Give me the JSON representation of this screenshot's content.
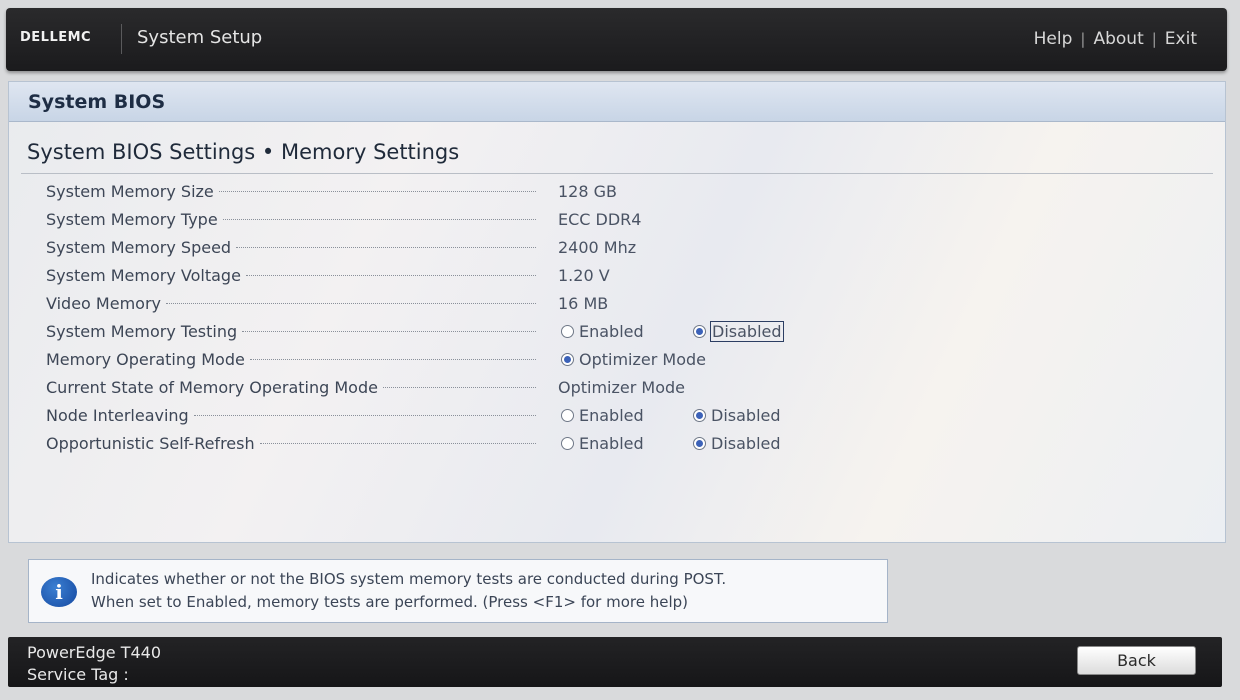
{
  "header": {
    "logo_text": "DELLEMC",
    "app_title": "System Setup",
    "links": [
      "Help",
      "About",
      "Exit"
    ],
    "link_separator": "|"
  },
  "panel": {
    "title": "System BIOS",
    "breadcrumb": "System BIOS Settings • Memory Settings"
  },
  "settings": [
    {
      "label": "System Memory Size",
      "value": "128 GB"
    },
    {
      "label": "System Memory Type",
      "value": "ECC DDR4"
    },
    {
      "label": "System Memory Speed",
      "value": "2400 Mhz"
    },
    {
      "label": "System Memory Voltage",
      "value": "1.20 V"
    },
    {
      "label": "Video Memory",
      "value": "16 MB"
    },
    {
      "label": "System Memory Testing",
      "options": [
        "Enabled",
        "Disabled"
      ],
      "selected": "Disabled"
    },
    {
      "label": "Memory Operating Mode",
      "options": [
        "Optimizer Mode"
      ],
      "selected": "Optimizer Mode"
    },
    {
      "label": "Current State of Memory Operating Mode",
      "value": "Optimizer Mode"
    },
    {
      "label": "Node Interleaving",
      "options": [
        "Enabled",
        "Disabled"
      ],
      "selected": "Disabled"
    },
    {
      "label": "Opportunistic Self-Refresh",
      "options": [
        "Enabled",
        "Disabled"
      ],
      "selected": "Disabled"
    }
  ],
  "help": {
    "icon": "info-icon",
    "line1": "Indicates whether or not the BIOS system memory tests are conducted during POST.",
    "line2": "When set to Enabled, memory tests are performed. (Press <F1> for more help)"
  },
  "footer": {
    "model": "PowerEdge T440",
    "service_tag_label": "Service Tag :",
    "back_label": "Back"
  },
  "colors": {
    "header_bg": "#1f1f21",
    "panel_header_bg": "#d3dded",
    "radio_selected": "#3c62b8"
  }
}
